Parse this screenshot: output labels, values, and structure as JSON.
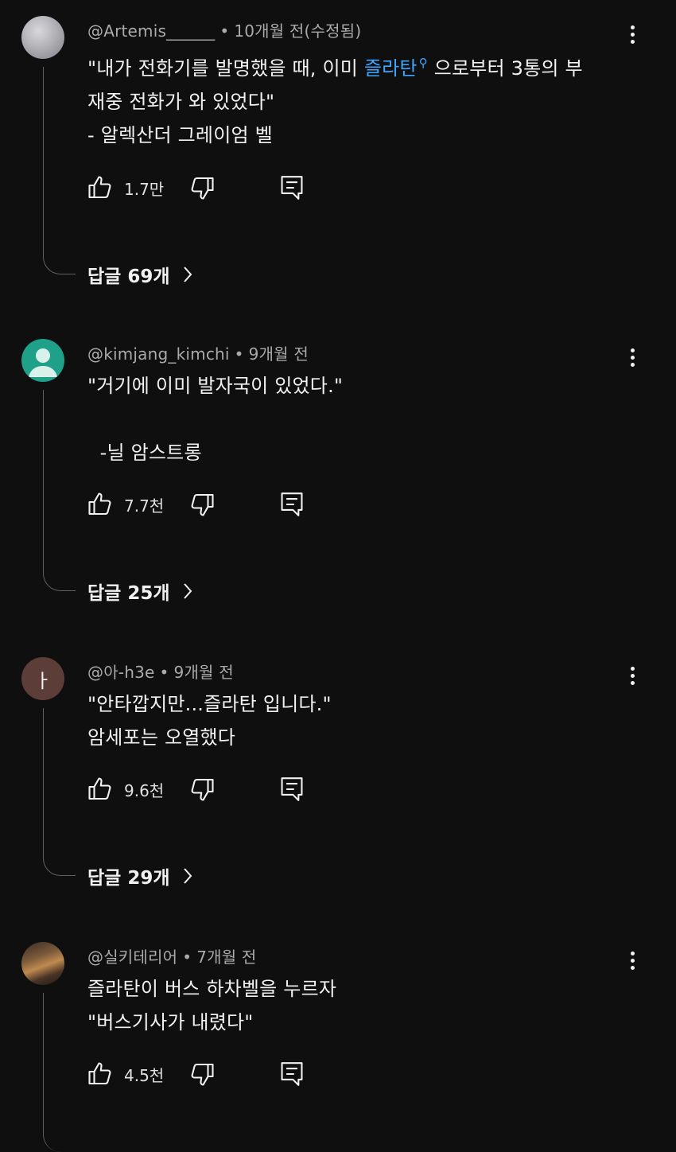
{
  "comments": [
    {
      "author": "@Artemis______",
      "time": "10개월 전(수정됨)",
      "line1_pre": "\"내가 전화기를 발명했을 때, 이미 ",
      "hashtag": "즐라탄",
      "line1_post": " 으로부터 3통의 부",
      "rest": "재중 전화가 와 있었다\"\n- 알렉산더 그레이엄 벨",
      "likes": "1.7만",
      "replies": "답글 69개"
    },
    {
      "author": "@kimjang_kimchi",
      "time": "9개월 전",
      "text": "\"거기에 이미 발자국이 있었다.\"\n\n  -닐 암스트롱",
      "likes": "7.7천",
      "replies": "답글 25개",
      "avatar_color": "#1fa189"
    },
    {
      "author": "@아-h3e",
      "time": "9개월 전",
      "text": "\"안타깝지만...즐라탄 입니다.\"\n암세포는 오열했다",
      "likes": "9.6천",
      "replies": "답글 29개",
      "avatar_initial": "ㅏ",
      "avatar_color": "#5d3d38"
    },
    {
      "author": "@실키테리어",
      "time": "7개월 전",
      "text": "즐라탄이 버스 하차벨을 누르자\n\"버스기사가 내렸다\"",
      "likes": "4.5천"
    }
  ],
  "dot": "•"
}
